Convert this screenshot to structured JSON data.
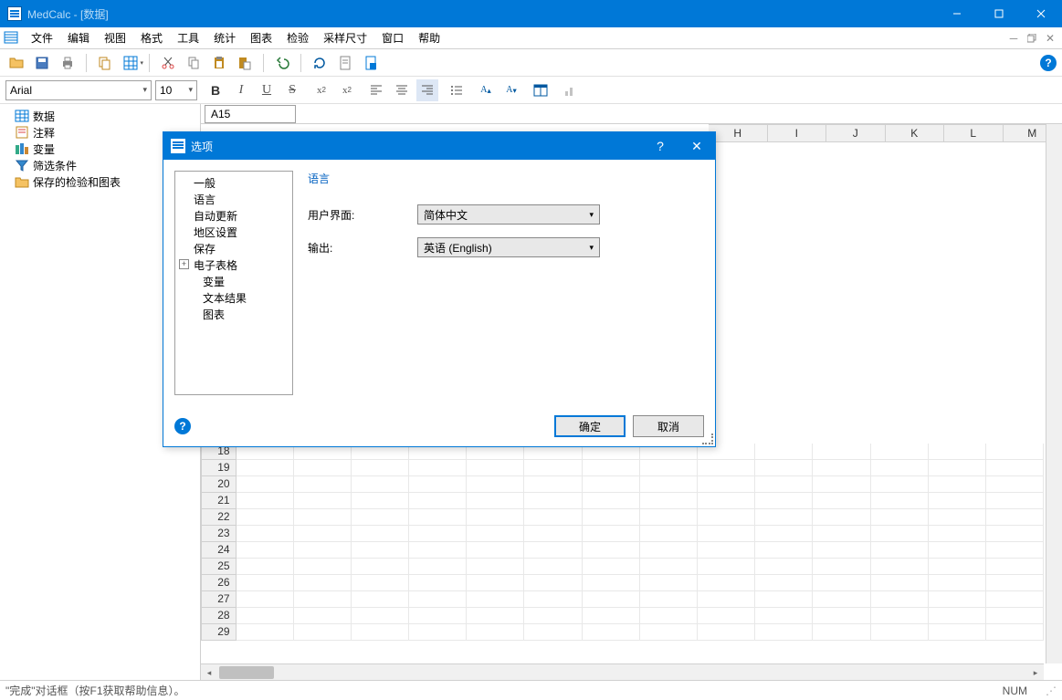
{
  "titlebar": {
    "text": "MedCalc - [数据]"
  },
  "menu": {
    "items": [
      "文件",
      "编辑",
      "视图",
      "格式",
      "工具",
      "统计",
      "图表",
      "检验",
      "采样尺寸",
      "窗口",
      "帮助"
    ]
  },
  "format": {
    "font": "Arial",
    "size": "10"
  },
  "cellref": "A15",
  "sidebar": {
    "items": [
      {
        "label": "数据",
        "icon": "grid"
      },
      {
        "label": "注释",
        "icon": "note"
      },
      {
        "label": "变量",
        "icon": "vars"
      },
      {
        "label": "筛选条件",
        "icon": "filter"
      },
      {
        "label": "保存的检验和图表",
        "icon": "folder"
      }
    ]
  },
  "columns": [
    "H",
    "I",
    "J",
    "K",
    "L",
    "M"
  ],
  "rows_visible": [
    18,
    19,
    20,
    21,
    22,
    23,
    24,
    25,
    26,
    27,
    28,
    29
  ],
  "status": {
    "left": "\"完成\"对话框（按F1获取帮助信息）。",
    "num": "NUM"
  },
  "dialog": {
    "title": "选项",
    "tree": [
      "一般",
      "语言",
      "自动更新",
      "地区设置",
      "保存",
      "电子表格",
      "变量",
      "文本结果",
      "图表"
    ],
    "tree_selected_index": 1,
    "tree_expandable_index": 5,
    "panel": {
      "heading": "语言",
      "rows": [
        {
          "label": "用户界面:",
          "value": "简体中文"
        },
        {
          "label": "输出:",
          "value": "英语 (English)"
        }
      ]
    },
    "buttons": {
      "ok": "确定",
      "cancel": "取消"
    }
  }
}
